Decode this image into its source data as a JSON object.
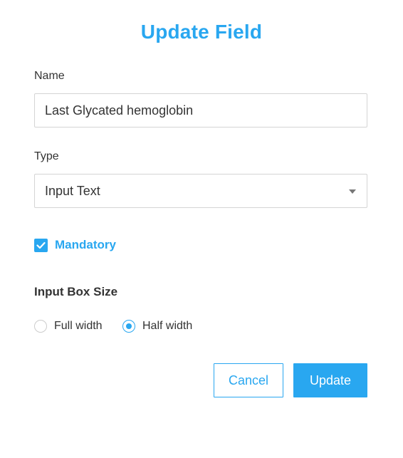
{
  "dialog": {
    "title": "Update Field"
  },
  "name_field": {
    "label": "Name",
    "value": "Last Glycated hemoglobin"
  },
  "type_field": {
    "label": "Type",
    "selected": "Input Text"
  },
  "mandatory": {
    "label": "Mandatory",
    "checked": true
  },
  "input_box_size": {
    "heading": "Input Box Size",
    "options": [
      {
        "label": "Full width",
        "selected": false
      },
      {
        "label": "Half width",
        "selected": true
      }
    ]
  },
  "actions": {
    "cancel_label": "Cancel",
    "update_label": "Update"
  },
  "colors": {
    "accent": "#29a7f0",
    "text": "#333333",
    "border": "#d4d4d4"
  }
}
